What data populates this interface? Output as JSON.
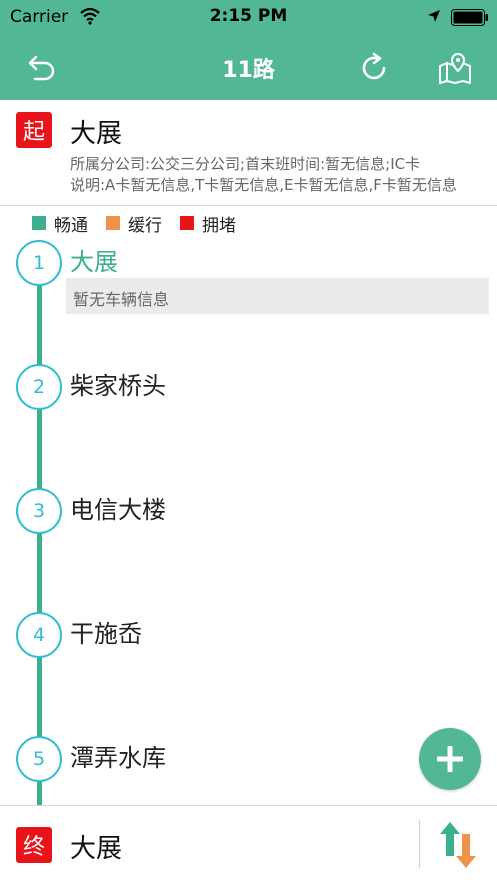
{
  "status_bar": {
    "carrier": "Carrier",
    "time": "2:15 PM"
  },
  "nav": {
    "title": "11路"
  },
  "start": {
    "tag": "起",
    "name": "大展",
    "desc_line1": "所属分公司:公交三分公司;首末班时间:暂无信息;IC卡",
    "desc_line2": "说明:A卡暂无信息,T卡暂无信息,E卡暂无信息,F卡暂无信息"
  },
  "legend": [
    {
      "label": "畅通",
      "color": "#3caf8e"
    },
    {
      "label": "缓行",
      "color": "#f0924a"
    },
    {
      "label": "拥堵",
      "color": "#e8141a"
    }
  ],
  "stops": [
    {
      "num": "1",
      "name": "大展",
      "info": "暂无车辆信息"
    },
    {
      "num": "2",
      "name": "柴家桥头"
    },
    {
      "num": "3",
      "name": "电信大楼"
    },
    {
      "num": "4",
      "name": "干施岙"
    },
    {
      "num": "5",
      "name": "潭弄水库"
    }
  ],
  "end": {
    "tag": "终",
    "name": "大展"
  },
  "colors": {
    "accent": "#52b894",
    "line": "#3caf8e",
    "stop_ring": "#2fbfcf",
    "tag_red": "#e8141a"
  },
  "icons": {
    "back": "back-arrow-icon",
    "refresh": "refresh-icon",
    "map": "map-pin-icon",
    "add": "plus-icon",
    "swap": "swap-direction-icon"
  }
}
